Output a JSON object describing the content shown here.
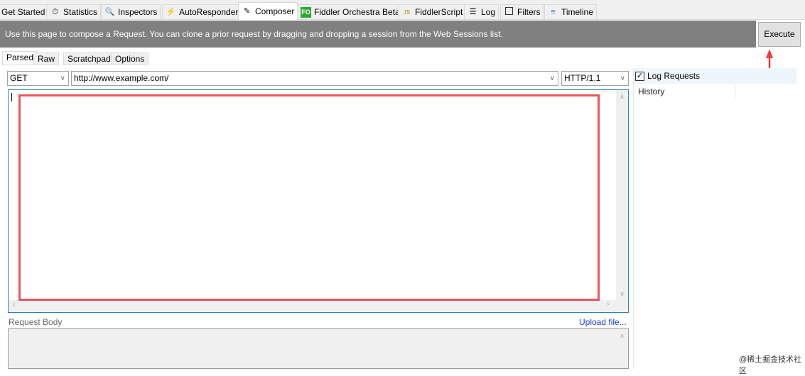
{
  "tabs": [
    {
      "label": "Get Started",
      "icon": ""
    },
    {
      "label": "Statistics",
      "icon": "stopwatch-icon"
    },
    {
      "label": "Inspectors",
      "icon": "magnifier-icon"
    },
    {
      "label": "AutoResponder",
      "icon": "lightning-icon"
    },
    {
      "label": "Composer",
      "icon": "pencil-note-icon",
      "active": true
    },
    {
      "label": "Fiddler Orchestra Beta",
      "icon": "fo-icon"
    },
    {
      "label": "FiddlerScript",
      "icon": "js-script-icon"
    },
    {
      "label": "Log",
      "icon": "document-icon"
    },
    {
      "label": "Filters",
      "icon": "checkbox-icon"
    },
    {
      "label": "Timeline",
      "icon": "timeline-icon"
    }
  ],
  "banner": "Use this page to compose a Request. You can clone a prior request by dragging and dropping a session from the Web Sessions list.",
  "execute_label": "Execute",
  "subtabs": [
    "Parsed",
    "Raw",
    "Scratchpad",
    "Options"
  ],
  "method": "GET",
  "url": "http://www.example.com/",
  "version": "HTTP/1.1",
  "log_requests_label": "Log Requests",
  "log_requests_checked": true,
  "history_label": "History",
  "request_body_label": "Request Body",
  "upload_label": "Upload file...",
  "watermark": "@稀土掘金技术社区",
  "colors": {
    "banner": "#808080",
    "highlight": "#e9545b",
    "link": "#1a3ec9"
  }
}
